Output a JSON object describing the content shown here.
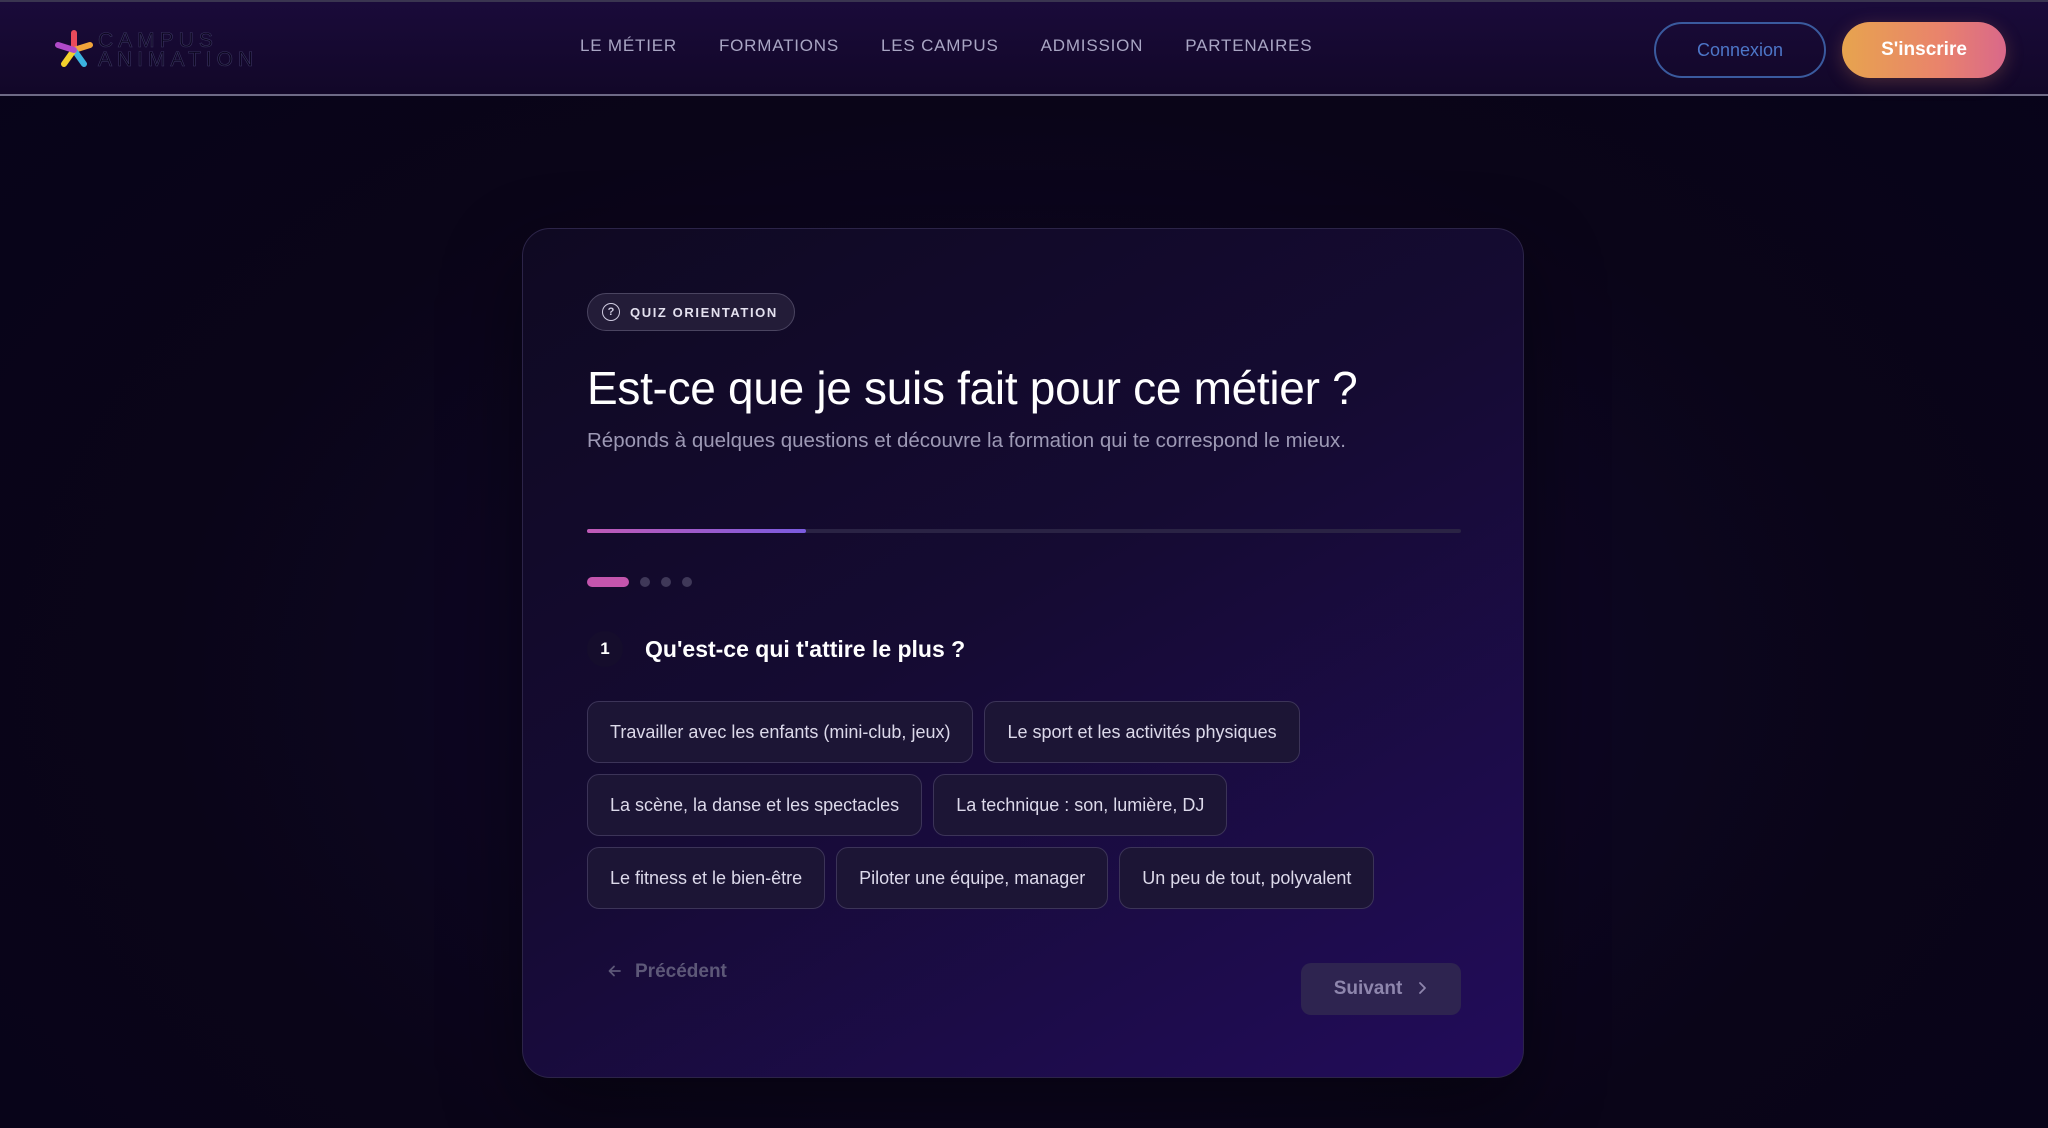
{
  "header": {
    "logo": {
      "line1": "CAMPUS",
      "line2": "ANIMATION"
    },
    "nav": [
      {
        "label": "LE MÉTIER"
      },
      {
        "label": "FORMATIONS"
      },
      {
        "label": "LES CAMPUS"
      },
      {
        "label": "ADMISSION"
      },
      {
        "label": "PARTENAIRES"
      }
    ],
    "login_label": "Connexion",
    "signup_label": "S'inscrire"
  },
  "quiz": {
    "badge": "QUIZ ORIENTATION",
    "badge_icon": "question-circle-icon",
    "title": "Est-ce que je suis fait pour ce métier ?",
    "subtitle": "Réponds à quelques questions et découvre la formation qui te correspond le mieux.",
    "progress_percent": 25,
    "current_step": 1,
    "total_steps": 4,
    "question": {
      "number": "1",
      "text": "Qu'est-ce qui t'attire le plus ?"
    },
    "options": [
      "Travailler avec les enfants (mini-club, jeux)",
      "Le sport et les activités physiques",
      "La scène, la danse et les spectacles",
      "La technique : son, lumière, DJ",
      "Le fitness et le bien-être",
      "Piloter une équipe, manager",
      "Un peu de tout, polyvalent"
    ],
    "prev_label": "Précédent",
    "next_label": "Suivant"
  },
  "colors": {
    "accent_gradient_start": "#e7a44e",
    "accent_gradient_end": "#d9688a",
    "progress_pink": "#c455ad",
    "progress_violet": "#7a5be0",
    "background": "#0a0518"
  }
}
